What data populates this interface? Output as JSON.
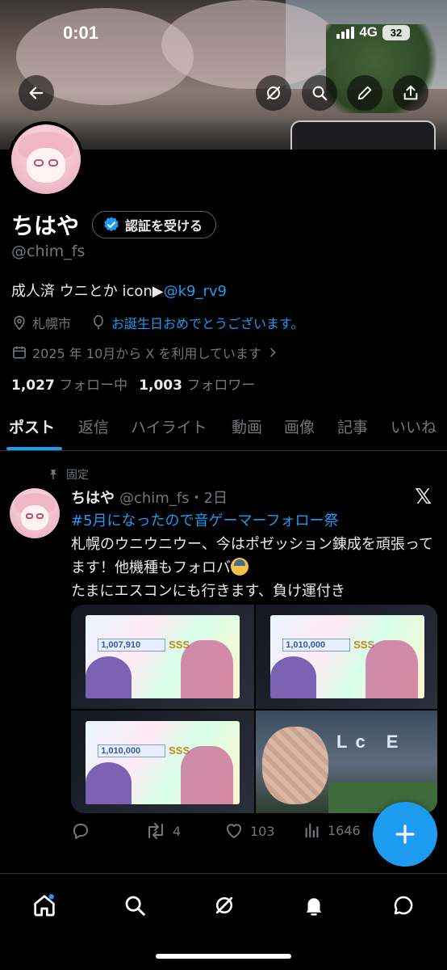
{
  "status_bar": {
    "time": "0:01",
    "network": "4G",
    "battery": "32"
  },
  "header": {
    "back_icon": "back-arrow-icon",
    "grok_icon": "grok-icon",
    "search_icon": "search-icon",
    "edit_icon": "pencil-icon",
    "share_icon": "share-icon"
  },
  "profile": {
    "name": "ちはや",
    "verify_label": "認証を受ける",
    "handle": "@chim_fs",
    "bio_text": "成人済 ウニとか icon▶︎",
    "bio_link": "@k9_rv9",
    "location": "札幌市",
    "birthday": "お誕生日おめでとうございます。",
    "joined": "2025 年 10月から X を利用しています",
    "following_count": "1,027",
    "following_label": "フォロー中",
    "followers_count": "1,003",
    "followers_label": "フォロワー"
  },
  "tabs": [
    "ポスト",
    "返信",
    "ハイライト",
    "動画",
    "画像",
    "記事",
    "いいね"
  ],
  "post": {
    "pinned_label": "固定",
    "name": "ちはや",
    "handle_time": "@chim_fs・2日",
    "hashtag": "#5月になったので音ゲーマーフォロー祭",
    "line1": "札幌のウニウニウー、今はポゼッション錬成を頑張ってます！他機種もフォロバ",
    "line2": "たまにエスコンにも行きます、負け運付き",
    "media": {
      "scores": [
        "1,007,910",
        "1,010,000",
        "1,010,000"
      ],
      "rank": "SSS",
      "board_text": "Lc E"
    },
    "stats": {
      "retweets": "4",
      "likes": "103",
      "views": "1646"
    }
  },
  "colors": {
    "accent": "#1d9bf0",
    "muted": "#71767b",
    "text": "#e7e9ea",
    "background": "#000000"
  }
}
